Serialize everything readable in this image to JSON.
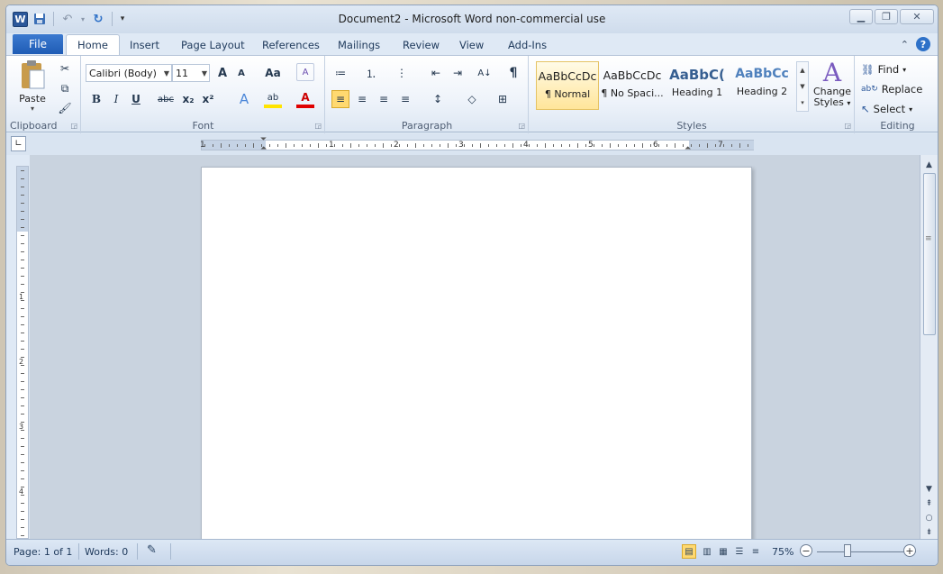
{
  "window": {
    "title": "Document2  -  Microsoft Word non-commercial use"
  },
  "qat": {
    "logo": "W",
    "save": "💾",
    "undo": "↶",
    "undo_arrow": "▾",
    "redo": "↻",
    "customize": "▾"
  },
  "tabs": {
    "file": "File",
    "home": "Home",
    "insert": "Insert",
    "page_layout": "Page Layout",
    "references": "References",
    "mailings": "Mailings",
    "review": "Review",
    "view": "View",
    "addins": "Add-Ins"
  },
  "clipboard": {
    "label": "Clipboard",
    "paste": "Paste",
    "paste_arrow": "▾",
    "cut": "✂",
    "copy": "⧉",
    "painter": "🖌"
  },
  "font": {
    "label": "Font",
    "name": "Calibri (Body)",
    "size": "11",
    "grow": "A",
    "shrink": "A",
    "case": "Aa",
    "clear": "A",
    "bold": "B",
    "italic": "I",
    "underline": "U",
    "strike": "abc",
    "sub": "x₂",
    "sup": "x²",
    "effects": "A",
    "highlight": "ab",
    "color": "A"
  },
  "paragraph": {
    "label": "Paragraph",
    "bullets": "≔",
    "numbering": "⒈",
    "multilevel": "⋮",
    "dec_indent": "⇤",
    "inc_indent": "⇥",
    "sort": "A↓",
    "show": "¶",
    "left": "≡",
    "center": "≡",
    "right": "≡",
    "justify": "≡",
    "spacing": "↕",
    "shading": "◇",
    "borders": "⊞"
  },
  "styles": {
    "label": "Styles",
    "items": [
      {
        "preview": "AaBbCcDc",
        "name": "¶ Normal",
        "color": "#1f1f1f"
      },
      {
        "preview": "AaBbCcDc",
        "name": "¶ No Spaci...",
        "color": "#1f1f1f"
      },
      {
        "preview": "AaBbC(",
        "name": "Heading 1",
        "color": "#365f91"
      },
      {
        "preview": "AaBbCc",
        "name": "Heading 2",
        "color": "#4f81bd"
      }
    ],
    "change": "Change Styles",
    "change_line1": "Change",
    "change_line2": "Styles",
    "change_arrow": "▾"
  },
  "editing": {
    "label": "Editing",
    "find": "Find",
    "find_arrow": "▾",
    "replace": "Replace",
    "select": "Select",
    "select_arrow": "▾"
  },
  "ruler": {
    "numbers": [
      "1",
      "1",
      "2",
      "3",
      "4",
      "5",
      "6",
      "7"
    ],
    "vnumbers": [
      "1",
      "2",
      "3",
      "4"
    ]
  },
  "status": {
    "page": "Page: 1 of 1",
    "words": "Words: 0",
    "zoom": "75%",
    "zoom_minus": "−",
    "zoom_plus": "+"
  },
  "colors": {
    "accent": "#2b579a",
    "file_tab": "#2a63b8"
  }
}
